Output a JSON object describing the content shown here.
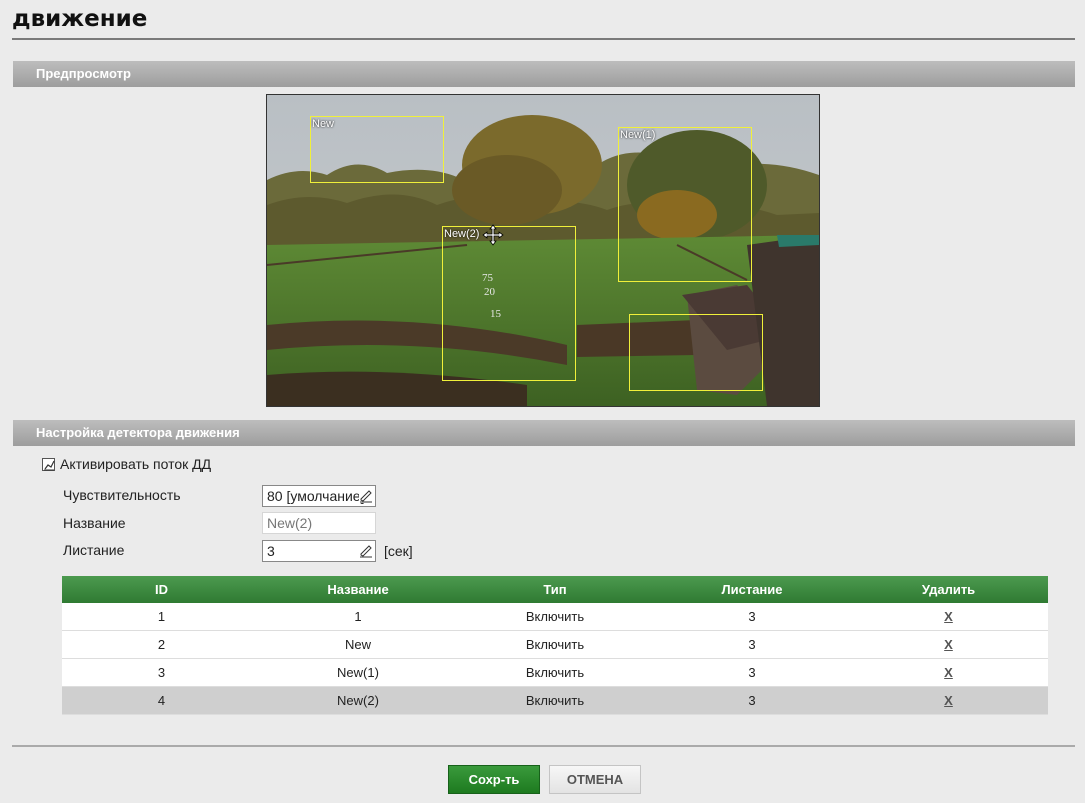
{
  "page": {
    "title": "движение"
  },
  "sections": {
    "preview": "Предпросмотр",
    "detector": "Настройка детектора движения"
  },
  "preview": {
    "zones": [
      {
        "label": "New"
      },
      {
        "label": "New(1)"
      },
      {
        "label": "New(2)"
      },
      {
        "label": ""
      }
    ]
  },
  "settings": {
    "activate_label": "Активировать поток ДД",
    "activate_checked": true,
    "sensitivity_label": "Чувствительность",
    "sensitivity_value": "80 [умолчание]",
    "name_label": "Название",
    "name_value": "New(2)",
    "dwell_label": "Листание",
    "dwell_value": "3",
    "dwell_unit": "[сек]"
  },
  "table": {
    "headers": [
      "ID",
      "Название",
      "Тип",
      "Листание",
      "Удалить"
    ],
    "rows": [
      {
        "id": "1",
        "name": "1",
        "type": "Включить",
        "dwell": "3",
        "delete": "X"
      },
      {
        "id": "2",
        "name": "New",
        "type": "Включить",
        "dwell": "3",
        "delete": "X"
      },
      {
        "id": "3",
        "name": "New(1)",
        "type": "Включить",
        "dwell": "3",
        "delete": "X"
      },
      {
        "id": "4",
        "name": "New(2)",
        "type": "Включить",
        "dwell": "3",
        "delete": "X"
      }
    ],
    "selected_row": 4
  },
  "buttons": {
    "save": "Сохр-ть",
    "cancel": "ОТМЕНА"
  },
  "colors": {
    "header_green": "#3a8a3d",
    "zone_yellow": "#f0f03a",
    "bar_gray": "#a9a9a9"
  }
}
